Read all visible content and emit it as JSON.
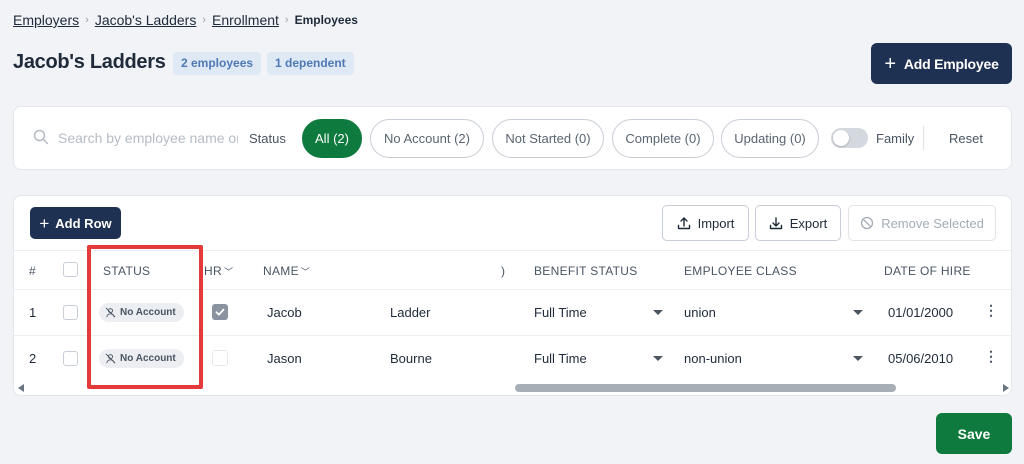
{
  "breadcrumb": {
    "items": [
      "Employers",
      "Jacob's Ladders",
      "Enrollment"
    ],
    "current": "Employees"
  },
  "header": {
    "title": "Jacob's Ladders",
    "employees_badge": "2 employees",
    "dependents_badge": "1 dependent",
    "add_employee_label": "Add Employee"
  },
  "filters": {
    "search_placeholder": "Search by employee name or",
    "status_label": "Status",
    "pills": [
      {
        "label": "All (2)",
        "active": true
      },
      {
        "label": "No Account (2)",
        "active": false
      },
      {
        "label": "Not Started (0)",
        "active": false
      },
      {
        "label": "Complete (0)",
        "active": false
      },
      {
        "label": "Updating (0)",
        "active": false
      }
    ],
    "family_label": "Family",
    "family_enabled": false,
    "reset_label": "Reset"
  },
  "toolbar": {
    "add_row_label": "Add Row",
    "import_label": "Import",
    "export_label": "Export",
    "remove_selected_label": "Remove Selected"
  },
  "table": {
    "columns": {
      "index": "#",
      "status": "STATUS",
      "hr": "HR",
      "name": "NAME",
      "partial": ")",
      "benefit_status": "BENEFIT STATUS",
      "employee_class": "EMPLOYEE CLASS",
      "date_of_hire": "DATE OF HIRE"
    },
    "rows": [
      {
        "index": "1",
        "status": "No Account",
        "hr": true,
        "first_name": "Jacob",
        "last_name": "Ladder",
        "benefit_status": "Full Time",
        "employee_class": "union",
        "date_of_hire": "01/01/2000"
      },
      {
        "index": "2",
        "status": "No Account",
        "hr": false,
        "first_name": "Jason",
        "last_name": "Bourne",
        "benefit_status": "Full Time",
        "employee_class": "non-union",
        "date_of_hire": "05/06/2010"
      }
    ]
  },
  "footer": {
    "save_label": "Save"
  },
  "colors": {
    "primary_navy": "#1e3152",
    "success_green": "#0f7a3d",
    "highlight_red": "#e53a3a",
    "badge_blue": "#4f79b5"
  }
}
